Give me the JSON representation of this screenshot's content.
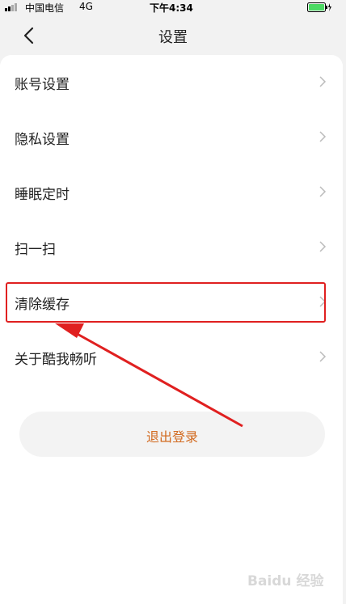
{
  "status_bar": {
    "carrier": "中国电信",
    "network": "4G",
    "time": "下午4:34"
  },
  "nav": {
    "title": "设置"
  },
  "menu": {
    "items": [
      {
        "label": "账号设置"
      },
      {
        "label": "隐私设置"
      },
      {
        "label": "睡眠定时"
      },
      {
        "label": "扫一扫"
      },
      {
        "label": "清除缓存"
      },
      {
        "label": "关于酷我畅听"
      }
    ],
    "highlighted_index": 4
  },
  "logout": {
    "label": "退出登录"
  },
  "watermark": {
    "text": "Baidu 经验"
  },
  "colors": {
    "accent": "#d2691e",
    "annotation": "#e02020",
    "battery": "#4cd964"
  },
  "icons": {
    "back": "chevron-left-icon",
    "item_arrow": "chevron-right-icon"
  }
}
